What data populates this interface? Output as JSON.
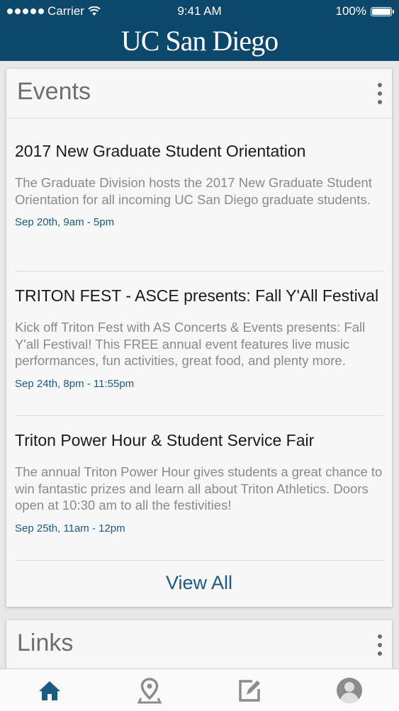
{
  "status_bar": {
    "carrier": "Carrier",
    "time": "9:41 AM",
    "battery": "100%"
  },
  "header": {
    "logo_text": "UC San Diego",
    "color": "#0b486c"
  },
  "events_card": {
    "title": "Events",
    "items": [
      {
        "title": "2017 New Graduate Student Orientation",
        "description": "The Graduate Division hosts the 2017 New Graduate Student Orientation for all incoming UC San Diego graduate students.",
        "time": "Sep 20th, 9am - 5pm"
      },
      {
        "title": "TRITON FEST - ASCE presents: Fall Y'All Festival",
        "description": "Kick off Triton Fest with AS Concerts & Events presents: Fall Y'all Festival! This FREE annual event features live music performances, fun activities, great food, and plenty more.",
        "time": "Sep 24th, 8pm - 11:55pm"
      },
      {
        "title": "Triton Power Hour & Student Service Fair",
        "description": "The annual Triton Power Hour gives students a great chance to win fantastic prizes and learn all about Triton Athletics. Doors open at 10:30 am to all the festivities!",
        "time": "Sep 25th, 11am - 12pm"
      }
    ],
    "view_all": "View All"
  },
  "links_card": {
    "title": "Links"
  },
  "tab_bar": {
    "tabs": [
      {
        "icon": "home-icon",
        "active": true
      },
      {
        "icon": "map-pin-icon",
        "active": false
      },
      {
        "icon": "edit-icon",
        "active": false
      },
      {
        "icon": "profile-icon",
        "active": false
      }
    ],
    "active_color": "#1b5a82",
    "inactive_color": "#8c8c8c"
  }
}
